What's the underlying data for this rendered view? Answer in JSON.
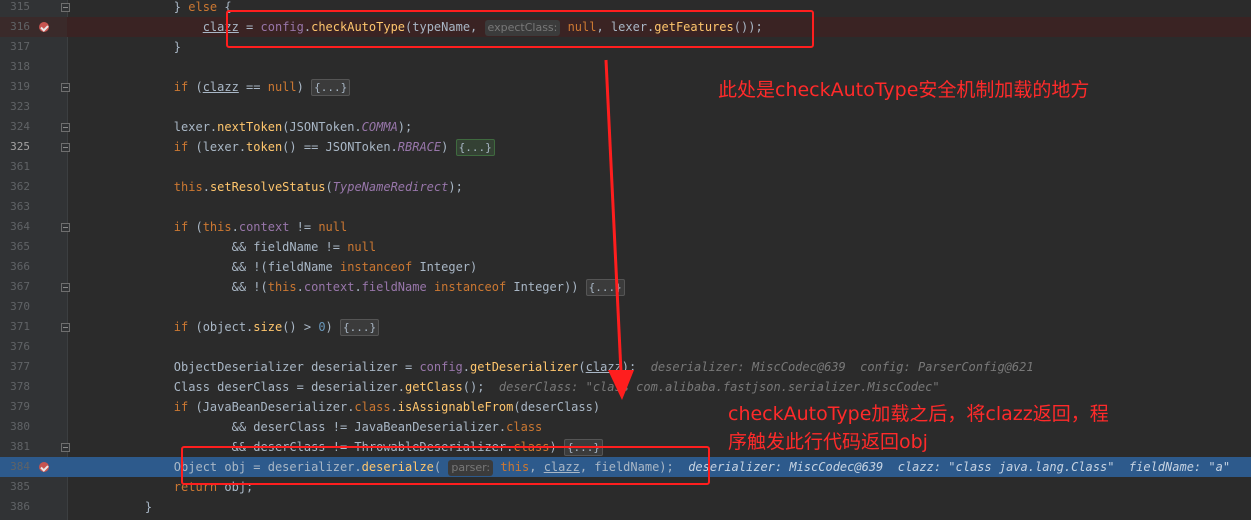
{
  "lines": [
    {
      "n": "315",
      "segs": [
        [
          "pl",
          "        } "
        ],
        [
          "kw",
          "else"
        ],
        [
          "pl",
          " {"
        ]
      ]
    },
    {
      "n": "316",
      "segs": [
        [
          "pl",
          "            "
        ],
        [
          "pl und",
          "clazz"
        ],
        [
          "pl",
          " = "
        ],
        [
          "fld",
          "config"
        ],
        [
          "pl",
          "."
        ],
        [
          "fn",
          "checkAutoType"
        ],
        [
          "pl",
          "(typeName, "
        ],
        [
          "hint",
          "expectClass:"
        ],
        [
          "kw",
          " null"
        ],
        [
          "pl",
          ", lexer."
        ],
        [
          "fn",
          "getFeatures"
        ],
        [
          "pl",
          "());"
        ]
      ]
    },
    {
      "n": "317",
      "segs": [
        [
          "pl",
          "        }"
        ]
      ]
    },
    {
      "n": "318",
      "segs": []
    },
    {
      "n": "319",
      "segs": [
        [
          "pl",
          "        "
        ],
        [
          "kw",
          "if"
        ],
        [
          "pl",
          " ("
        ],
        [
          "pl und",
          "clazz"
        ],
        [
          "pl",
          " == "
        ],
        [
          "kw",
          "null"
        ],
        [
          "pl",
          ") "
        ],
        [
          "folded",
          "{...}"
        ]
      ]
    },
    {
      "n": "323",
      "segs": []
    },
    {
      "n": "324",
      "segs": [
        [
          "pl",
          "        lexer."
        ],
        [
          "fn",
          "nextToken"
        ],
        [
          "pl",
          "(JSONToken."
        ],
        [
          "it",
          "COMMA"
        ],
        [
          "pl",
          ");"
        ]
      ]
    },
    {
      "n": "325",
      "segs": [
        [
          "pl",
          "        "
        ],
        [
          "kw",
          "if"
        ],
        [
          "pl",
          " (lexer."
        ],
        [
          "fn",
          "token"
        ],
        [
          "pl",
          "() == JSONToken."
        ],
        [
          "it",
          "RBRACE"
        ],
        [
          "pl",
          ") "
        ],
        [
          "folded green",
          "{...}"
        ]
      ]
    },
    {
      "n": "361",
      "segs": []
    },
    {
      "n": "362",
      "segs": [
        [
          "pl",
          "        "
        ],
        [
          "kw",
          "this"
        ],
        [
          "pl",
          "."
        ],
        [
          "fn",
          "setResolveStatus"
        ],
        [
          "pl",
          "("
        ],
        [
          "it",
          "TypeNameRedirect"
        ],
        [
          "pl",
          ");"
        ]
      ]
    },
    {
      "n": "363",
      "segs": []
    },
    {
      "n": "364",
      "segs": [
        [
          "pl",
          "        "
        ],
        [
          "kw",
          "if"
        ],
        [
          "pl",
          " ("
        ],
        [
          "kw",
          "this"
        ],
        [
          "pl",
          "."
        ],
        [
          "fld",
          "context"
        ],
        [
          "pl",
          " != "
        ],
        [
          "kw",
          "null"
        ]
      ]
    },
    {
      "n": "365",
      "segs": [
        [
          "pl",
          "                && fieldName != "
        ],
        [
          "kw",
          "null"
        ]
      ]
    },
    {
      "n": "366",
      "segs": [
        [
          "pl",
          "                && !(fieldName "
        ],
        [
          "kw",
          "instanceof"
        ],
        [
          "pl",
          " Integer)"
        ]
      ]
    },
    {
      "n": "367",
      "segs": [
        [
          "pl",
          "                && !("
        ],
        [
          "kw",
          "this"
        ],
        [
          "pl",
          "."
        ],
        [
          "fld",
          "context"
        ],
        [
          "pl",
          "."
        ],
        [
          "fld",
          "fieldName"
        ],
        [
          "pl",
          " "
        ],
        [
          "kw",
          "instanceof"
        ],
        [
          "pl",
          " Integer)) "
        ],
        [
          "folded",
          "{...}"
        ]
      ]
    },
    {
      "n": "370",
      "segs": []
    },
    {
      "n": "371",
      "segs": [
        [
          "pl",
          "        "
        ],
        [
          "kw",
          "if"
        ],
        [
          "pl",
          " (object."
        ],
        [
          "fn",
          "size"
        ],
        [
          "pl",
          "() > "
        ],
        [
          "num",
          "0"
        ],
        [
          "pl",
          ") "
        ],
        [
          "folded",
          "{...}"
        ]
      ]
    },
    {
      "n": "376",
      "segs": []
    },
    {
      "n": "377",
      "segs": [
        [
          "pl",
          "        ObjectDeserializer deserializer = "
        ],
        [
          "fld",
          "config"
        ],
        [
          "pl",
          "."
        ],
        [
          "fn",
          "getDeserializer"
        ],
        [
          "pl",
          "("
        ],
        [
          "pl und",
          "clazz"
        ],
        [
          "pl",
          ");  "
        ],
        [
          "inline",
          "deserializer: MiscCodec@639  config: ParserConfig@621"
        ]
      ]
    },
    {
      "n": "378",
      "segs": [
        [
          "pl",
          "        Class deserClass = deserializer."
        ],
        [
          "fn",
          "getClass"
        ],
        [
          "pl",
          "();  "
        ],
        [
          "inline",
          "deserClass: \"class com.alibaba.fastjson.serializer.MiscCodec\""
        ]
      ]
    },
    {
      "n": "379",
      "segs": [
        [
          "pl",
          "        "
        ],
        [
          "kw",
          "if"
        ],
        [
          "pl",
          " (JavaBeanDeserializer."
        ],
        [
          "kw",
          "class"
        ],
        [
          "pl",
          "."
        ],
        [
          "fn",
          "isAssignableFrom"
        ],
        [
          "pl",
          "(deserClass)"
        ]
      ]
    },
    {
      "n": "380",
      "segs": [
        [
          "pl",
          "                && deserClass != JavaBeanDeserializer."
        ],
        [
          "kw",
          "class"
        ]
      ]
    },
    {
      "n": "381",
      "segs": [
        [
          "pl",
          "                && deserClass != ThrowableDeserializer."
        ],
        [
          "kw",
          "class"
        ],
        [
          "pl",
          ") "
        ],
        [
          "folded",
          "{...}"
        ]
      ]
    },
    {
      "n": "384",
      "segs": [
        [
          "pl",
          "        Object obj = deserializer."
        ],
        [
          "fn",
          "deserialze"
        ],
        [
          "pl",
          "( "
        ],
        [
          "hint",
          "parser:"
        ],
        [
          "kw",
          " this"
        ],
        [
          "pl",
          ", "
        ],
        [
          "pl und",
          "clazz"
        ],
        [
          "pl",
          ", fieldName);  "
        ],
        [
          "inline",
          "deserializer: MiscCodec@639  clazz: \"class java.lang.Class\"  fieldName: \"a\""
        ]
      ]
    },
    {
      "n": "385",
      "segs": [
        [
          "pl",
          "        "
        ],
        [
          "kw",
          "return"
        ],
        [
          "pl",
          " obj;"
        ]
      ]
    },
    {
      "n": "386",
      "segs": [
        [
          "pl",
          "    }"
        ]
      ]
    }
  ],
  "breakpoint_lines": [
    "316",
    "384"
  ],
  "fold_lines": [
    "315",
    "319",
    "324",
    "325",
    "364",
    "367",
    "371",
    "381"
  ],
  "annotations": {
    "note1": "此处是checkAutoType安全机制加载的地方",
    "note2_line1": "checkAutoType加载之后，将clazz返回，程",
    "note2_line2": "序触发此行代码返回obj"
  },
  "colors": {
    "annotation_red": "#ff1e1e",
    "current_line": "#2d5a8c",
    "keyword": "#cc7832",
    "method": "#ffc66d"
  }
}
